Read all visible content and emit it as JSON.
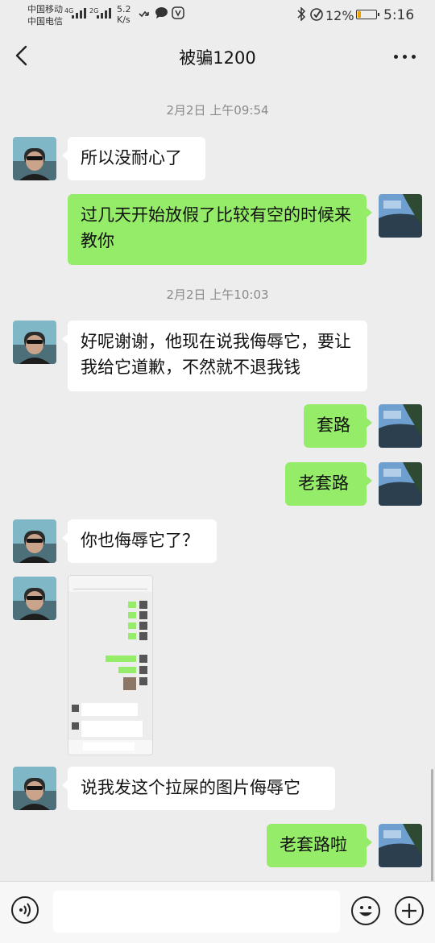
{
  "status_bar": {
    "carrier1": "中国移动",
    "carrier2": "中国电信",
    "sig1_tag": "4G",
    "sig2_tag": "2G",
    "speed_value": "5.2",
    "speed_unit": "K/s",
    "battery": "12%",
    "battery_level": 0.12,
    "time": "5:16"
  },
  "nav": {
    "title": "被骗1200",
    "back_icon": "chevron-left-icon",
    "more_icon": "more-dots-icon"
  },
  "timestamps": [
    "2月2日 上午09:54",
    "2月2日 上午10:03"
  ],
  "messages": [
    {
      "side": "in",
      "text": "所以没耐心了"
    },
    {
      "side": "out",
      "text": "过几天开始放假了比较有空的时候来教你"
    },
    {
      "side": "in",
      "text": "好呢谢谢，他现在说我侮辱它，要让我给它道歉，不然就不退我钱"
    },
    {
      "side": "out",
      "text": "套路"
    },
    {
      "side": "out",
      "text": "老套路"
    },
    {
      "side": "in",
      "text": "你也侮辱它了？"
    },
    {
      "side": "in",
      "type": "image"
    },
    {
      "side": "in",
      "text": "说我发这个拉屎的图片侮辱它"
    },
    {
      "side": "out",
      "text": "老套路啦"
    }
  ],
  "input_bar": {
    "voice_icon": "voice-icon",
    "emoji_icon": "emoji-icon",
    "plus_icon": "plus-icon"
  },
  "colors": {
    "background": "#ededed",
    "out_bubble": "#95ec69",
    "in_bubble": "#ffffff"
  }
}
